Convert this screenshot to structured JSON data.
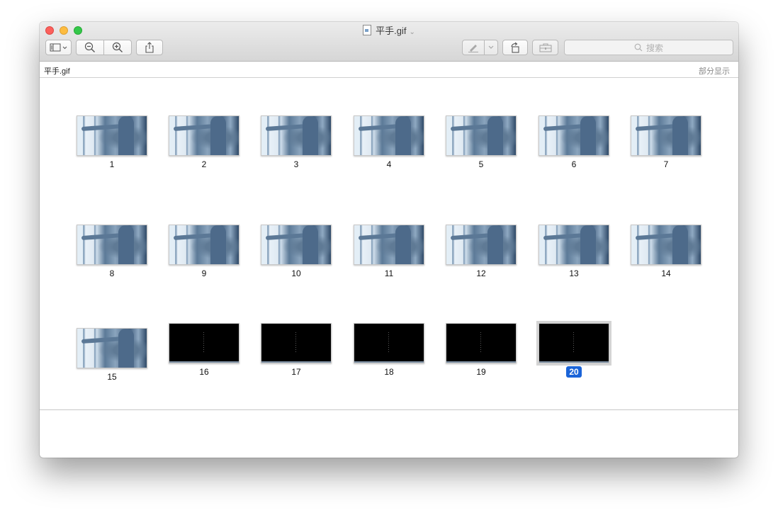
{
  "window": {
    "title": "平手.gif",
    "file_name_label": "平手.gif",
    "display_mode_label": "部分显示"
  },
  "toolbar": {
    "search_placeholder": "搜索",
    "buttons": [
      "sidebar-toggle-icon",
      "zoom-out-icon",
      "zoom-in-icon",
      "share-icon",
      "markup-pen-icon",
      "rotate-icon",
      "toolbox-icon"
    ]
  },
  "frames": [
    {
      "label": "1",
      "kind": "photo"
    },
    {
      "label": "2",
      "kind": "photo"
    },
    {
      "label": "3",
      "kind": "photo"
    },
    {
      "label": "4",
      "kind": "photo"
    },
    {
      "label": "5",
      "kind": "photo"
    },
    {
      "label": "6",
      "kind": "photo"
    },
    {
      "label": "7",
      "kind": "photo"
    },
    {
      "label": "8",
      "kind": "photo"
    },
    {
      "label": "9",
      "kind": "photo"
    },
    {
      "label": "10",
      "kind": "photo"
    },
    {
      "label": "11",
      "kind": "photo"
    },
    {
      "label": "12",
      "kind": "photo"
    },
    {
      "label": "13",
      "kind": "photo"
    },
    {
      "label": "14",
      "kind": "photo"
    },
    {
      "label": "15",
      "kind": "photo"
    },
    {
      "label": "16",
      "kind": "black"
    },
    {
      "label": "17",
      "kind": "black"
    },
    {
      "label": "18",
      "kind": "black"
    },
    {
      "label": "19",
      "kind": "black"
    },
    {
      "label": "20",
      "kind": "black",
      "selected": true
    }
  ],
  "colors": {
    "selection_accent": "#1a64d8",
    "close": "#fc605c",
    "minimize": "#fdbc40",
    "maximize": "#34c84a"
  }
}
